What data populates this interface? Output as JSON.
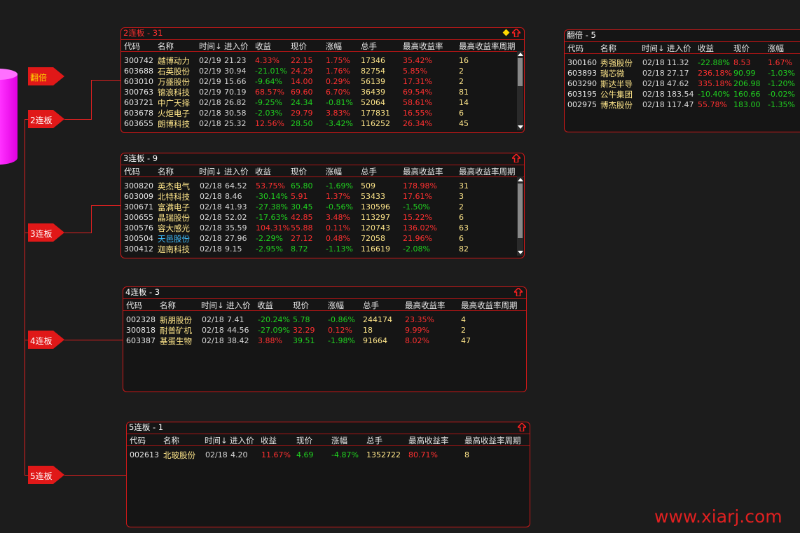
{
  "tree": {
    "nodes": [
      {
        "label": "翻倍"
      },
      {
        "label": "2连板"
      },
      {
        "label": "3连板"
      },
      {
        "label": "4连板"
      },
      {
        "label": "5连板"
      }
    ]
  },
  "columns": [
    "代码",
    "名称",
    "时间↓",
    "进入价",
    "收益",
    "现价",
    "涨幅",
    "总手",
    "最高收益率",
    "最高收益率周期"
  ],
  "fanbei_columns": [
    "代码",
    "名称",
    "时间↓",
    "进入价",
    "收益",
    "现价",
    "涨幅"
  ],
  "panels": {
    "p2": {
      "title": "2连板 - 31",
      "rows": [
        {
          "code": "300742",
          "name": "越博动力",
          "time": "02/19",
          "entry": "21.23",
          "ret": "4.33%",
          "price": "22.15",
          "chg": "1.75%",
          "vol": "17346",
          "max": "35.42%",
          "period": "16",
          "rc": "up",
          "pc": "up",
          "cc": "up",
          "mc": "up"
        },
        {
          "code": "603688",
          "name": "石英股份",
          "time": "02/19",
          "entry": "30.94",
          "ret": "-21.01%",
          "price": "24.29",
          "chg": "1.76%",
          "vol": "82754",
          "max": "5.85%",
          "period": "2",
          "rc": "dn",
          "pc": "up",
          "cc": "up",
          "mc": "up"
        },
        {
          "code": "603010",
          "name": "万盛股份",
          "time": "02/19",
          "entry": "15.66",
          "ret": "-9.64%",
          "price": "14.00",
          "chg": "0.29%",
          "vol": "56139",
          "max": "17.31%",
          "period": "2",
          "rc": "dn",
          "pc": "up",
          "cc": "up",
          "mc": "up"
        },
        {
          "code": "300763",
          "name": "锦浪科技",
          "time": "02/19",
          "entry": "70.19",
          "ret": "68.57%",
          "price": "69.60",
          "chg": "6.70%",
          "vol": "36439",
          "max": "69.54%",
          "period": "81",
          "rc": "up",
          "pc": "up",
          "cc": "up",
          "mc": "up"
        },
        {
          "code": "603721",
          "name": "中广天择",
          "time": "02/18",
          "entry": "26.82",
          "ret": "-9.25%",
          "price": "24.34",
          "chg": "-0.81%",
          "vol": "52064",
          "max": "58.61%",
          "period": "14",
          "rc": "dn",
          "pc": "dn",
          "cc": "dn",
          "mc": "up"
        },
        {
          "code": "603678",
          "name": "火炬电子",
          "time": "02/18",
          "entry": "30.58",
          "ret": "-2.03%",
          "price": "29.79",
          "chg": "3.83%",
          "vol": "177831",
          "max": "16.55%",
          "period": "6",
          "rc": "dn",
          "pc": "up",
          "cc": "up",
          "mc": "up"
        },
        {
          "code": "603655",
          "name": "朗博科技",
          "time": "02/18",
          "entry": "25.32",
          "ret": "12.56%",
          "price": "28.50",
          "chg": "-3.42%",
          "vol": "116252",
          "max": "26.34%",
          "period": "45",
          "rc": "up",
          "pc": "dn",
          "cc": "dn",
          "mc": "up"
        }
      ]
    },
    "p3": {
      "title": "3连板 - 9",
      "rows": [
        {
          "code": "300820",
          "name": "英杰电气",
          "time": "02/18",
          "entry": "64.52",
          "ret": "53.75%",
          "price": "65.80",
          "chg": "-1.69%",
          "vol": "509",
          "max": "178.98%",
          "period": "31",
          "rc": "up",
          "pc": "dn",
          "cc": "dn",
          "mc": "up"
        },
        {
          "code": "603009",
          "name": "北特科技",
          "time": "02/18",
          "entry": "8.46",
          "ret": "-30.14%",
          "price": "5.91",
          "chg": "1.37%",
          "vol": "53433",
          "max": "17.61%",
          "period": "3",
          "rc": "dn",
          "pc": "up",
          "cc": "up",
          "mc": "up"
        },
        {
          "code": "300671",
          "name": "富满电子",
          "time": "02/18",
          "entry": "41.93",
          "ret": "-27.38%",
          "price": "30.45",
          "chg": "-0.56%",
          "vol": "130596",
          "max": "-1.50%",
          "period": "2",
          "rc": "dn",
          "pc": "dn",
          "cc": "dn",
          "mc": "dn"
        },
        {
          "code": "300655",
          "name": "晶瑞股份",
          "time": "02/18",
          "entry": "52.02",
          "ret": "-17.63%",
          "price": "42.85",
          "chg": "3.48%",
          "vol": "113297",
          "max": "15.22%",
          "period": "6",
          "rc": "dn",
          "pc": "up",
          "cc": "up",
          "mc": "up"
        },
        {
          "code": "300576",
          "name": "容大感光",
          "time": "02/18",
          "entry": "35.59",
          "ret": "104.31%",
          "price": "55.88",
          "chg": "0.11%",
          "vol": "120743",
          "max": "136.02%",
          "period": "63",
          "rc": "up",
          "pc": "up",
          "cc": "up",
          "mc": "up"
        },
        {
          "code": "300504",
          "name": "天邑股份",
          "time": "02/18",
          "entry": "27.96",
          "ret": "-2.29%",
          "price": "27.12",
          "chg": "0.48%",
          "vol": "72058",
          "max": "21.96%",
          "period": "6",
          "rc": "dn",
          "pc": "up",
          "cc": "up",
          "mc": "up",
          "blue": true
        },
        {
          "code": "300412",
          "name": "迦南科技",
          "time": "02/18",
          "entry": "9.15",
          "ret": "-2.95%",
          "price": "8.72",
          "chg": "-1.13%",
          "vol": "116619",
          "max": "-2.08%",
          "period": "82",
          "rc": "dn",
          "pc": "dn",
          "cc": "dn",
          "mc": "dn"
        }
      ]
    },
    "p4": {
      "title": "4连板 - 3",
      "rows": [
        {
          "code": "002328",
          "name": "新朋股份",
          "time": "02/18",
          "entry": "7.41",
          "ret": "-20.24%",
          "price": "5.78",
          "chg": "-0.86%",
          "vol": "244174",
          "max": "23.35%",
          "period": "4",
          "rc": "dn",
          "pc": "dn",
          "cc": "dn",
          "mc": "up"
        },
        {
          "code": "300818",
          "name": "耐普矿机",
          "time": "02/18",
          "entry": "44.56",
          "ret": "-27.09%",
          "price": "32.29",
          "chg": "0.12%",
          "vol": "18",
          "max": "9.99%",
          "period": "2",
          "rc": "dn",
          "pc": "up",
          "cc": "up",
          "mc": "up"
        },
        {
          "code": "603387",
          "name": "基蛋生物",
          "time": "02/18",
          "entry": "38.42",
          "ret": "3.88%",
          "price": "39.51",
          "chg": "-1.98%",
          "vol": "91664",
          "max": "8.02%",
          "period": "47",
          "rc": "up",
          "pc": "dn",
          "cc": "dn",
          "mc": "up"
        }
      ]
    },
    "p5": {
      "title": "5连板 - 1",
      "rows": [
        {
          "code": "002613",
          "name": "北玻股份",
          "time": "02/18",
          "entry": "4.20",
          "ret": "11.67%",
          "price": "4.69",
          "chg": "-4.87%",
          "vol": "1352722",
          "max": "80.71%",
          "period": "8",
          "rc": "up",
          "pc": "dn",
          "cc": "dn",
          "mc": "up"
        }
      ]
    },
    "pf": {
      "title": "翻倍 - 5",
      "rows": [
        {
          "code": "300160",
          "name": "秀强股份",
          "time": "02/18",
          "entry": "11.32",
          "ret": "-22.88%",
          "price": "8.53",
          "chg": "1.67%",
          "rc": "dn",
          "pc": "up",
          "cc": "up"
        },
        {
          "code": "603893",
          "name": "瑞芯微",
          "time": "02/18",
          "entry": "27.17",
          "ret": "236.18%",
          "price": "90.99",
          "chg": "-1.03%",
          "rc": "up",
          "pc": "dn",
          "cc": "dn"
        },
        {
          "code": "603290",
          "name": "斯达半导",
          "time": "02/18",
          "entry": "47.62",
          "ret": "335.18%",
          "price": "206.98",
          "chg": "-1.20%",
          "rc": "up",
          "pc": "dn",
          "cc": "dn"
        },
        {
          "code": "603195",
          "name": "公牛集团",
          "time": "02/18",
          "entry": "183.54",
          "ret": "-10.40%",
          "price": "160.66",
          "chg": "-0.02%",
          "rc": "dn",
          "pc": "dn",
          "cc": "dn"
        },
        {
          "code": "002975",
          "name": "博杰股份",
          "time": "02/18",
          "entry": "117.47",
          "ret": "55.78%",
          "price": "183.00",
          "chg": "-1.35%",
          "rc": "up",
          "pc": "dn",
          "cc": "dn"
        }
      ]
    }
  },
  "watermark": "www.xiarj.com",
  "colors": {
    "accent": "#e02020",
    "up": "#ff3030",
    "down": "#20d020",
    "name": "#ffe68a",
    "magenta": "#ff30ff"
  }
}
